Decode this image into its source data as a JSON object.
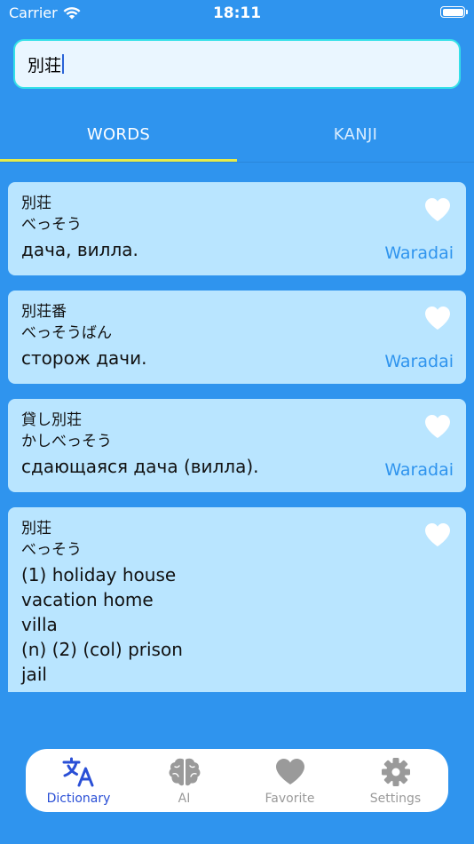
{
  "status_bar": {
    "carrier": "Carrier",
    "time": "18:11"
  },
  "search": {
    "value": "別荘"
  },
  "tabs": [
    {
      "label": "WORDS",
      "active": true
    },
    {
      "label": "KANJI",
      "active": false
    }
  ],
  "results": [
    {
      "kanji": "別荘",
      "kana": "べっそう",
      "translation": "дача, вилла.",
      "source": "Waradai"
    },
    {
      "kanji": "別荘番",
      "kana": "べっそうばん",
      "translation": "сторож дачи.",
      "source": "Waradai"
    },
    {
      "kanji": "貸し別荘",
      "kana": "かしべっそう",
      "translation": "сдающаяся дача (вилла).",
      "source": "Waradai"
    },
    {
      "kanji": "別荘",
      "kana": "べっそう",
      "translation": "(1) holiday house\nvacation home\nvilla\n(n) (2) (col) prison\njail",
      "source": ""
    }
  ],
  "nav": [
    {
      "label": "Dictionary",
      "icon": "translate-icon",
      "active": true
    },
    {
      "label": "AI",
      "icon": "brain-icon",
      "active": false
    },
    {
      "label": "Favorite",
      "icon": "heart-icon",
      "active": false
    },
    {
      "label": "Settings",
      "icon": "gear-icon",
      "active": false
    }
  ],
  "colors": {
    "background": "#2f94ee",
    "card": "#b9e5ff",
    "accent": "#2a4fd6",
    "tab_indicator": "#e6ec4a",
    "search_border": "#34e0e8"
  }
}
